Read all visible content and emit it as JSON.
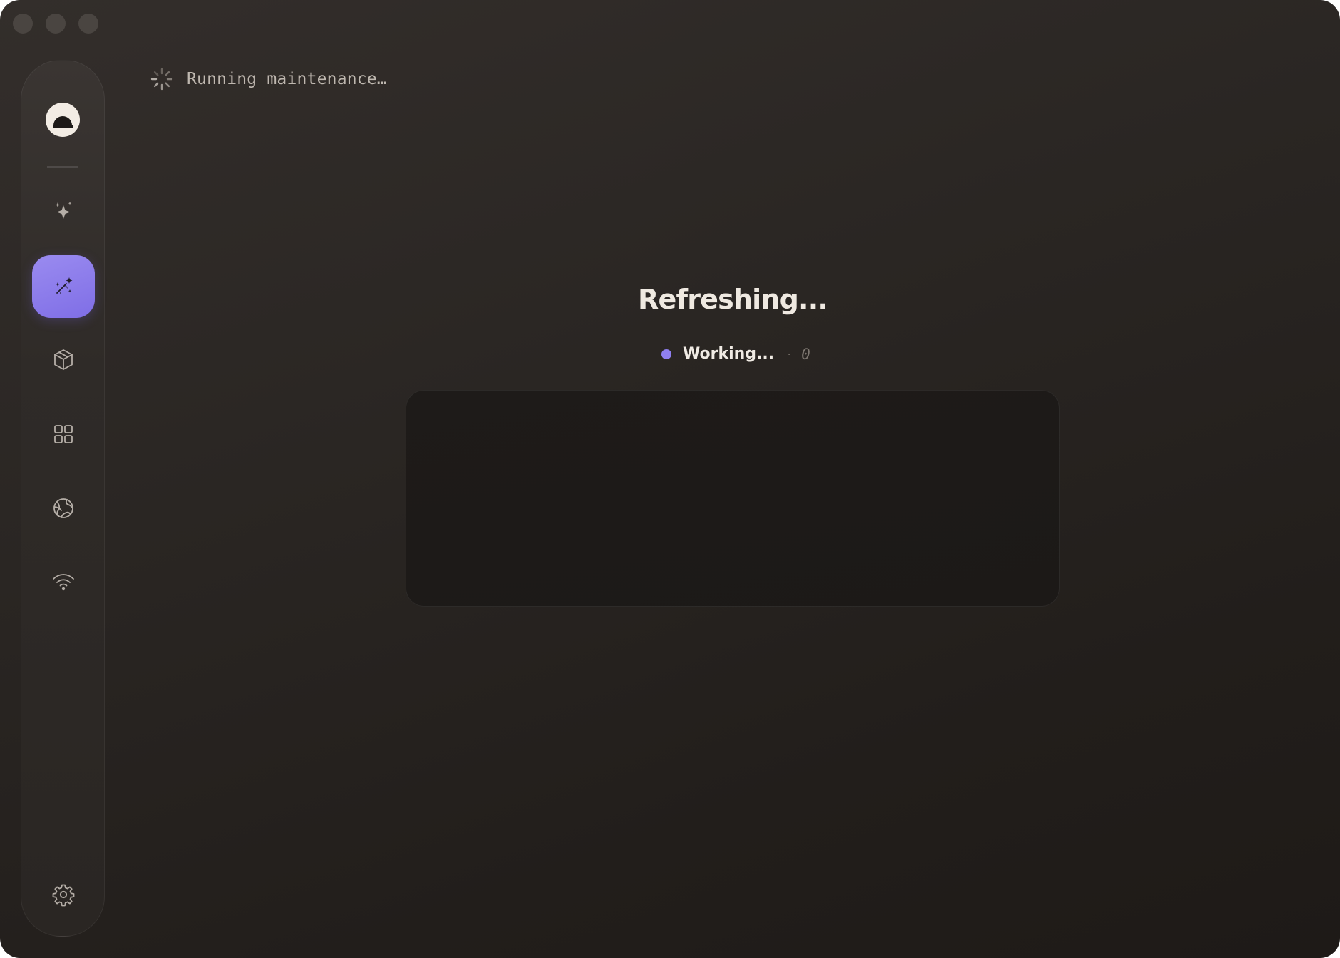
{
  "window": {
    "traffic_lights": [
      "close",
      "minimize",
      "maximize"
    ]
  },
  "sidebar": {
    "avatar_icon": "half-moon-logo-icon",
    "items": [
      {
        "name": "sparkle",
        "icon": "sparkle-icon",
        "active": false
      },
      {
        "name": "magic-wand",
        "icon": "magic-wand-icon",
        "active": true
      },
      {
        "name": "package",
        "icon": "cube-icon",
        "active": false
      },
      {
        "name": "apps",
        "icon": "grid-icon",
        "active": false
      },
      {
        "name": "network",
        "icon": "globe-icon",
        "active": false
      },
      {
        "name": "wifi",
        "icon": "wifi-icon",
        "active": false
      }
    ],
    "settings_icon": "gear-icon"
  },
  "status": {
    "text": "Running maintenance…",
    "icon": "spinner-icon"
  },
  "main": {
    "title": "Refreshing...",
    "state_label": "Working...",
    "separator": "·",
    "count": "0"
  },
  "colors": {
    "accent": "#8f7ff0",
    "background": "#2a2623",
    "text": "#efe9e1"
  }
}
